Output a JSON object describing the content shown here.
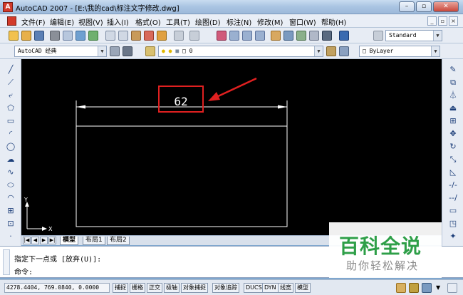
{
  "titlebar": {
    "app_icon": "autocad-logo-icon",
    "title": "AutoCAD 2007 - [E:\\我的cad\\标注文字修改.dwg]",
    "minimize_glyph": "–",
    "restore_glyph": "▫",
    "close_glyph": "✕"
  },
  "menubar": {
    "items": [
      "文件(F)",
      "编辑(E)",
      "视图(V)",
      "插入(I)",
      "格式(O)",
      "工具(T)",
      "绘图(D)",
      "标注(N)",
      "修改(M)",
      "窗口(W)",
      "帮助(H)"
    ],
    "mdi_minimize": "_",
    "mdi_restore": "▫",
    "mdi_close": "×"
  },
  "toolbar1": {
    "text_style": "Standard"
  },
  "toolbar2": {
    "workspace": "AutoCAD 经典",
    "layer": "0",
    "linetype": "ByLayer"
  },
  "drawing": {
    "dimension_text": "62",
    "annotation_color": "#e02020",
    "ucs_x_label": "X",
    "ucs_y_label": "Y"
  },
  "layout_tabs": {
    "nav": [
      "|◀",
      "◀",
      "▶",
      "▶|"
    ],
    "tabs": [
      "模型",
      "布局1",
      "布局2"
    ],
    "active": "模型"
  },
  "command": {
    "line1": "指定下一点或 [放弃(U)]:",
    "line2": "命令:"
  },
  "watermark": {
    "title": "百科全说",
    "subtitle": "助你轻松解决"
  },
  "statusbar": {
    "coords": "4278.4404, 769.0840, 0.0000",
    "toggles": [
      "捕捉",
      "栅格",
      "正交",
      "极轴",
      "对象捕捉",
      "对象追踪",
      "DUCS",
      "DYN",
      "线宽",
      "模型"
    ]
  }
}
